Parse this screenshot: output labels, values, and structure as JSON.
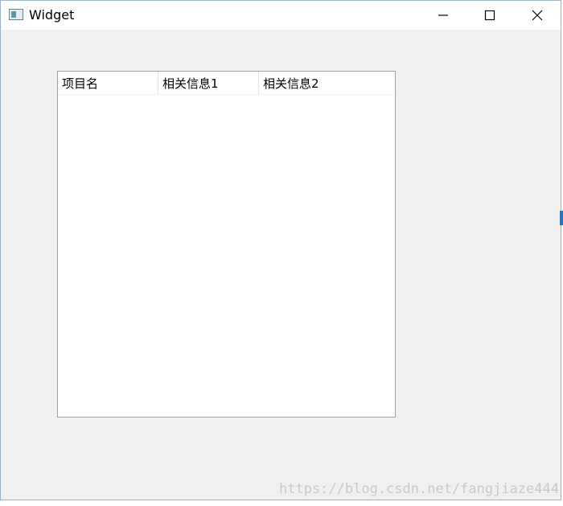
{
  "window": {
    "title": "Widget"
  },
  "tree": {
    "columns": [
      "项目名",
      "相关信息1",
      "相关信息2"
    ]
  },
  "watermark": {
    "text": "https://blog.csdn.net/fangjiaze444"
  },
  "colors": {
    "window_bg": "#f0f0f0",
    "titlebar_bg": "#ffffff",
    "tree_border": "#a0a0a0",
    "watermark": "#c9c9c9"
  }
}
